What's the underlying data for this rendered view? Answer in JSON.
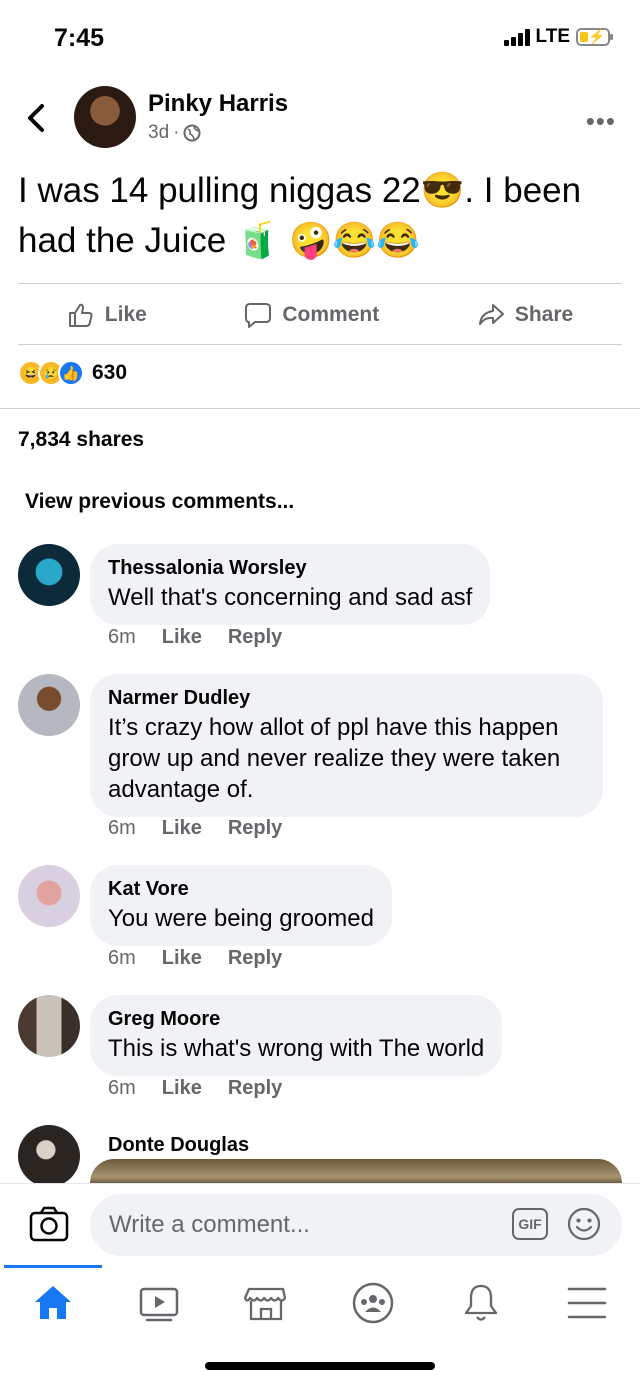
{
  "status_bar": {
    "time": "7:45",
    "network": "LTE"
  },
  "post": {
    "author": "Pinky Harris",
    "age": "3d",
    "text": "I was 14 pulling niggas 22😎. I been had the Juice 🧃 🤪😂😂",
    "actions": {
      "like": "Like",
      "comment": "Comment",
      "share": "Share"
    },
    "reaction_count": "630",
    "shares": "7,834 shares"
  },
  "view_previous": "View previous comments...",
  "comments": [
    {
      "name": "Thessalonia Worsley",
      "text": "Well that's concerning and sad asf",
      "time": "6m",
      "like": "Like",
      "reply": "Reply"
    },
    {
      "name": "Narmer Dudley",
      "text": "It’s crazy how allot of ppl have this happen grow up and never realize they were taken advantage of.",
      "time": "6m",
      "like": "Like",
      "reply": "Reply"
    },
    {
      "name": "Kat Vore",
      "text": "You were being groomed",
      "time": "6m",
      "like": "Like",
      "reply": "Reply"
    },
    {
      "name": "Greg Moore",
      "text": "This is what's wrong with The  world",
      "time": "6m",
      "like": "Like",
      "reply": "Reply"
    },
    {
      "name": "Donte Douglas"
    }
  ],
  "composer": {
    "placeholder": "Write a comment...",
    "gif_label": "GIF"
  },
  "tabs": [
    "home-icon",
    "watch-icon",
    "marketplace-icon",
    "groups-icon",
    "notifications-icon",
    "menu-icon"
  ],
  "colors": {
    "brand": "#1877f2",
    "bubble": "#f0f2f5",
    "secondary_text": "#65676b"
  }
}
